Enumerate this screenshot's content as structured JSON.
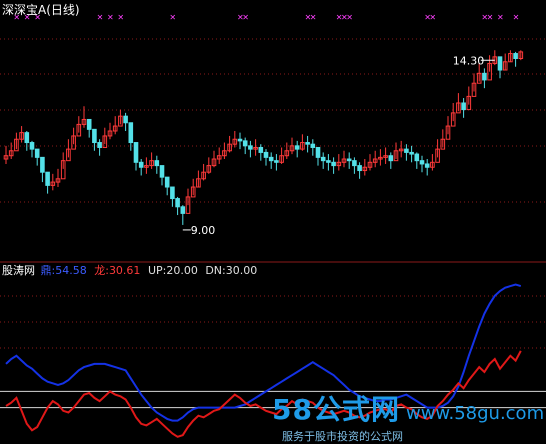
{
  "header": {
    "title": "深深宝A",
    "period": "(日线)",
    "indicator_name": "股涛网",
    "line1_label": "鼎:",
    "line1_value": "54.58",
    "line2_label": "龙:",
    "line2_value": "30.61",
    "up_label": "UP:",
    "up_value": "20.00",
    "dn_label": "DN:",
    "dn_value": "30.00"
  },
  "colors": {
    "up_candle": "#ff3a3a",
    "down_candle": "#54e1e8",
    "grid": "#8b1a1a",
    "line1": "#1432e6",
    "line2": "#e01818",
    "marker": "#ff40ff",
    "ref_line": "#d8d8d8"
  },
  "watermark": {
    "brand": "58公式网",
    "url": "www.58gu.com",
    "slogan": "服务于股市投资的公式网"
  },
  "chart_data": [
    {
      "type": "candlestick",
      "title": "深深宝A (日线)",
      "ylim": [
        8.3,
        15.4
      ],
      "grid": "dotted horizontal",
      "annotations": [
        {
          "text": "14.30",
          "kind": "high"
        },
        {
          "text": "9.00",
          "kind": "low"
        }
      ],
      "markers": {
        "symbol": "✕",
        "x_index": [
          2,
          4,
          6,
          18,
          20,
          22,
          32,
          45,
          46,
          58,
          59,
          64,
          65,
          66,
          81,
          82,
          92,
          93,
          95,
          98
        ]
      },
      "close": [
        11.1,
        11.25,
        11.6,
        11.8,
        11.5,
        11.3,
        11.05,
        10.6,
        10.2,
        10.3,
        10.4,
        10.95,
        11.3,
        11.7,
        12.05,
        12.2,
        11.9,
        11.5,
        11.35,
        11.7,
        11.85,
        12.0,
        12.3,
        12.1,
        11.5,
        10.9,
        10.75,
        10.8,
        10.95,
        10.8,
        10.45,
        10.15,
        9.8,
        9.55,
        9.35,
        9.85,
        10.15,
        10.4,
        10.6,
        10.8,
        11.0,
        11.1,
        11.25,
        11.45,
        11.6,
        11.55,
        11.4,
        11.3,
        11.35,
        11.2,
        11.05,
        10.95,
        10.9,
        11.1,
        11.25,
        11.4,
        11.3,
        11.5,
        11.45,
        11.35,
        11.05,
        10.95,
        10.9,
        10.8,
        10.9,
        11.0,
        10.95,
        10.8,
        10.65,
        10.75,
        10.9,
        11.0,
        11.05,
        11.1,
        10.95,
        11.25,
        11.3,
        11.2,
        11.15,
        10.95,
        10.85,
        10.75,
        10.9,
        11.3,
        11.6,
        12.0,
        12.4,
        12.7,
        12.5,
        12.9,
        13.3,
        13.6,
        13.4,
        13.9,
        14.1,
        13.7,
        13.95,
        14.2,
        14.05,
        14.25
      ],
      "high": [
        11.4,
        11.5,
        11.8,
        12.0,
        11.85,
        11.55,
        11.3,
        10.9,
        10.45,
        10.55,
        10.7,
        11.2,
        11.6,
        11.95,
        12.3,
        12.6,
        12.2,
        11.8,
        11.6,
        11.95,
        12.1,
        12.3,
        12.5,
        12.4,
        11.85,
        11.2,
        11.0,
        11.05,
        11.2,
        11.1,
        10.75,
        10.4,
        10.05,
        9.85,
        9.6,
        10.1,
        10.4,
        10.65,
        10.85,
        11.05,
        11.25,
        11.35,
        11.5,
        11.7,
        11.85,
        11.8,
        11.65,
        11.55,
        11.6,
        11.45,
        11.3,
        11.2,
        11.15,
        11.35,
        11.5,
        11.65,
        11.55,
        11.75,
        11.7,
        11.6,
        11.3,
        11.2,
        11.15,
        11.05,
        11.15,
        11.25,
        11.2,
        11.05,
        10.9,
        11.0,
        11.15,
        11.25,
        11.3,
        11.35,
        11.2,
        11.5,
        11.55,
        11.45,
        11.4,
        11.2,
        11.1,
        11.0,
        11.15,
        11.6,
        11.9,
        12.3,
        12.7,
        13.0,
        12.85,
        13.2,
        13.6,
        13.9,
        13.75,
        14.15,
        14.3,
        14.0,
        14.2,
        14.3,
        14.25,
        14.3
      ],
      "low": [
        10.85,
        11.0,
        11.3,
        11.5,
        11.25,
        11.05,
        10.8,
        10.3,
        9.95,
        10.05,
        10.15,
        10.7,
        11.05,
        11.45,
        11.8,
        11.95,
        11.65,
        11.25,
        11.1,
        11.45,
        11.6,
        11.75,
        12.05,
        11.85,
        11.25,
        10.65,
        10.5,
        10.55,
        10.7,
        10.55,
        10.2,
        9.9,
        9.55,
        9.3,
        9.0,
        9.6,
        9.9,
        10.15,
        10.35,
        10.55,
        10.75,
        10.85,
        11.0,
        11.2,
        11.35,
        11.3,
        11.15,
        11.05,
        11.1,
        10.95,
        10.8,
        10.7,
        10.65,
        10.85,
        11.0,
        11.15,
        11.05,
        11.25,
        11.2,
        11.1,
        10.8,
        10.7,
        10.65,
        10.55,
        10.65,
        10.75,
        10.7,
        10.55,
        10.4,
        10.5,
        10.65,
        10.75,
        10.8,
        10.85,
        10.7,
        11.0,
        11.05,
        10.95,
        10.9,
        10.7,
        10.6,
        10.5,
        10.65,
        11.05,
        11.35,
        11.75,
        12.15,
        12.45,
        12.25,
        12.65,
        13.05,
        13.35,
        13.15,
        13.65,
        13.85,
        13.45,
        13.7,
        13.95,
        13.8,
        14.0
      ]
    },
    {
      "type": "line",
      "title": "股涛网",
      "ylim": [
        0,
        100
      ],
      "reference_lines": [
        20,
        30
      ],
      "series": [
        {
          "name": "鼎",
          "values": [
            47,
            50,
            52,
            49,
            46,
            44,
            41,
            38,
            36,
            35,
            34,
            35,
            37,
            40,
            43,
            45,
            46,
            47,
            47,
            47,
            46,
            45,
            44,
            43,
            38,
            33,
            28,
            24,
            20,
            17,
            15,
            13,
            12,
            12,
            14,
            17,
            19,
            20,
            20,
            20,
            20,
            20,
            20,
            20,
            20,
            21,
            22,
            24,
            26,
            28,
            30,
            32,
            34,
            36,
            38,
            40,
            42,
            44,
            46,
            48,
            46,
            44,
            42,
            40,
            37,
            34,
            31,
            29,
            27,
            26,
            25,
            24,
            24,
            25,
            25,
            26,
            27,
            28,
            26,
            24,
            22,
            20,
            20,
            20,
            21,
            23,
            27,
            33,
            42,
            52,
            61,
            70,
            78,
            84,
            89,
            92,
            94,
            95,
            96,
            95
          ]
        },
        {
          "name": "龙",
          "values": [
            21,
            23,
            26,
            18,
            10,
            6,
            8,
            14,
            20,
            24,
            22,
            18,
            17,
            20,
            24,
            28,
            29,
            26,
            24,
            27,
            30,
            28,
            27,
            25,
            20,
            14,
            10,
            9,
            11,
            13,
            10,
            7,
            4,
            2,
            3,
            8,
            12,
            15,
            14,
            16,
            18,
            19,
            22,
            25,
            28,
            26,
            23,
            21,
            22,
            20,
            18,
            17,
            16,
            19,
            21,
            24,
            22,
            25,
            24,
            23,
            20,
            18,
            17,
            16,
            17,
            18,
            17,
            15,
            14,
            15,
            17,
            18,
            19,
            19,
            17,
            21,
            22,
            20,
            19,
            16,
            14,
            13,
            15,
            21,
            24,
            28,
            31,
            35,
            32,
            37,
            41,
            45,
            42,
            47,
            50,
            44,
            48,
            52,
            49,
            55
          ]
        }
      ]
    }
  ]
}
